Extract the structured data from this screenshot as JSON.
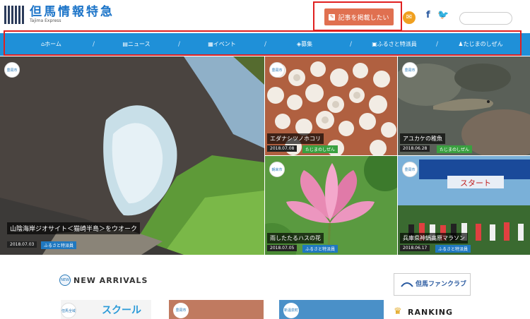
{
  "logo": {
    "title": "但馬情報特急",
    "subtitle": "Tajima Express"
  },
  "header": {
    "post_button_label": "記事を掲載したい",
    "search_placeholder": ""
  },
  "nav": {
    "items": [
      {
        "icon": "⌂",
        "label": "ホーム"
      },
      {
        "icon": "▤",
        "label": "ニュース"
      },
      {
        "icon": "▦",
        "label": "イベント"
      },
      {
        "icon": "◈",
        "label": "募集"
      },
      {
        "icon": "▣",
        "label": "ふるさと特派員"
      },
      {
        "icon": "♟",
        "label": "たじまのしぜん"
      }
    ]
  },
  "tiles": [
    {
      "region": "豊岡市",
      "title": "山陰海岸ジオサイト＜猫崎半島＞をウオーク",
      "date": "2018.07.03",
      "tag": "ふるさと特派員",
      "tag_color": "blue"
    },
    {
      "region": "豊岡市",
      "title": "エダナシツノホコリ",
      "date": "2018.07.08",
      "tag": "たじまのしぜん",
      "tag_color": "green"
    },
    {
      "region": "豊岡市",
      "title": "アユカケの稚魚",
      "date": "2018.06.28",
      "tag": "たじまのしぜん",
      "tag_color": "green"
    },
    {
      "region": "朝来市",
      "title": "雨したたるハスの花",
      "date": "2018.07.05",
      "tag": "ふるさと特派員",
      "tag_color": "blue"
    },
    {
      "region": "豊岡市",
      "title": "兵庫県神鍋高原マラソン",
      "date": "2018.06.17",
      "tag": "ふるさと特派員",
      "tag_color": "blue"
    }
  ],
  "sections": {
    "new_arrivals": "NEW ARRIVALS",
    "new_icon": "NEW",
    "fanclub": "但馬ファンクラブ",
    "ranking": "RANKING"
  },
  "bottom_cards": [
    {
      "region": "但馬全域",
      "text": "スクール"
    },
    {
      "region": "豊岡市",
      "text": ""
    },
    {
      "region": "新温泉町",
      "text": ""
    }
  ],
  "colors": {
    "nav_bg": "#1f90d8",
    "post_button": "#e07050",
    "highlight": "#e02020",
    "brand": "#1a73c8"
  }
}
